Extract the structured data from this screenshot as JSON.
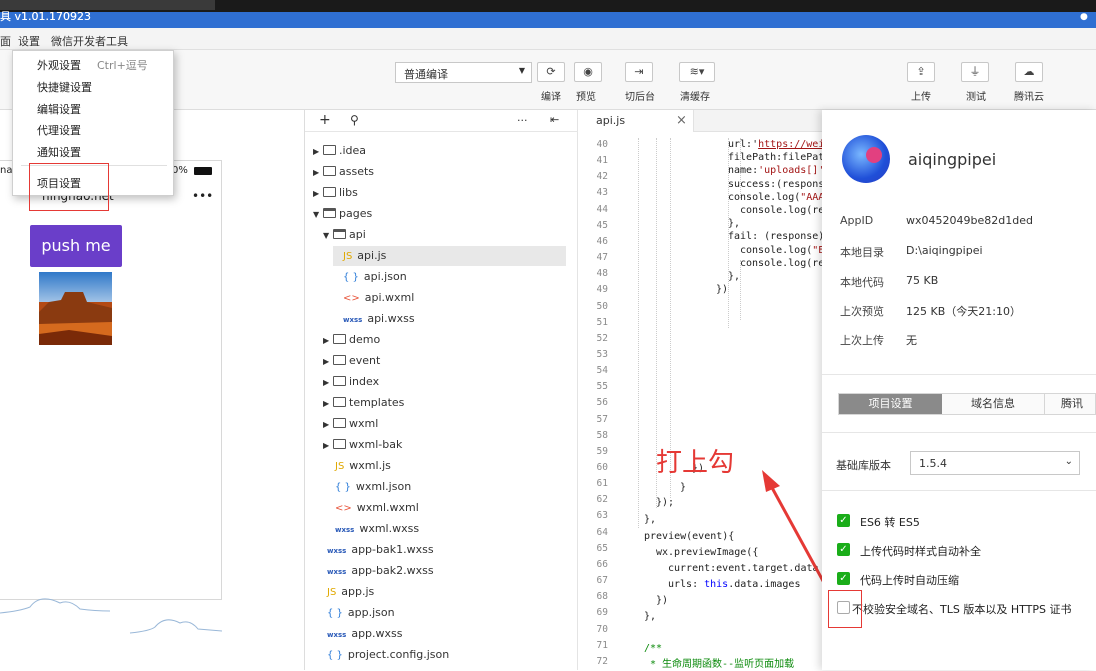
{
  "window": {
    "title_fragment": "具 v1.01.170923"
  },
  "menubar": {
    "items": [
      "面",
      "设置",
      "微信开发者工具"
    ]
  },
  "dropdown": {
    "items": [
      {
        "label": "外观设置",
        "shortcut": "Ctrl+逗号"
      },
      {
        "label": "快捷键设置"
      },
      {
        "label": "编辑设置"
      },
      {
        "label": "代理设置"
      },
      {
        "label": "通知设置"
      },
      {
        "label": "项目设置"
      }
    ]
  },
  "toolbar": {
    "compile_mode": "普通编译",
    "compile_label": "编译",
    "preview_label": "预览",
    "background_label": "切后台",
    "clear_cache_label": "清缓存",
    "upload_label": "上传",
    "test_label": "测试",
    "cloud_label": "腾讯云"
  },
  "simulator": {
    "status_left": "nat",
    "battery_text": "0%",
    "nav_title": "ninghao.net",
    "more": "•••",
    "button_label": "push me"
  },
  "file_tree": {
    "add": "+",
    "search": "⚲",
    "more": "···",
    "collapse": "⇤",
    "items": [
      {
        "name": ".idea",
        "type": "folder"
      },
      {
        "name": "assets",
        "type": "folder"
      },
      {
        "name": "libs",
        "type": "folder"
      },
      {
        "name": "pages",
        "type": "folder-open"
      },
      {
        "name": "api",
        "type": "folder-open"
      },
      {
        "name": "api.js",
        "type": "js"
      },
      {
        "name": "api.json",
        "type": "json"
      },
      {
        "name": "api.wxml",
        "type": "wxml"
      },
      {
        "name": "api.wxss",
        "type": "wxss"
      },
      {
        "name": "demo",
        "type": "folder"
      },
      {
        "name": "event",
        "type": "folder"
      },
      {
        "name": "index",
        "type": "folder"
      },
      {
        "name": "templates",
        "type": "folder"
      },
      {
        "name": "wxml",
        "type": "folder"
      },
      {
        "name": "wxml-bak",
        "type": "folder"
      },
      {
        "name": "wxml.js",
        "type": "js"
      },
      {
        "name": "wxml.json",
        "type": "json"
      },
      {
        "name": "wxml.wxml",
        "type": "wxml"
      },
      {
        "name": "wxml.wxss",
        "type": "wxss"
      },
      {
        "name": "app-bak1.wxss",
        "type": "wxss"
      },
      {
        "name": "app-bak2.wxss",
        "type": "wxss"
      },
      {
        "name": "app.js",
        "type": "js"
      },
      {
        "name": "app.json",
        "type": "json"
      },
      {
        "name": "app.wxss",
        "type": "wxss"
      },
      {
        "name": "project.config.json",
        "type": "json"
      }
    ]
  },
  "editor": {
    "tab_label": "api.js",
    "tab_close": "×",
    "line_numbers": [
      "40",
      "41",
      "42",
      "43",
      "44",
      "45",
      "46",
      "47",
      "48",
      "49",
      "50",
      "51",
      "52",
      "53",
      "54",
      "55",
      "56",
      "57",
      "58",
      "59",
      "60",
      "61",
      "62",
      "63",
      "64",
      "65",
      "66",
      "67",
      "68",
      "69",
      "70",
      "71",
      "72"
    ],
    "code": {
      "l40a": "url:'",
      "l40b": "https://wei",
      "l41": "filePath:filePat",
      "l42a": "name:",
      "l42b": "'uploads[]'",
      "l43": "success:(respons",
      "l44a": "console.log(",
      "l44b": "\"AAA",
      "l45": "console.log(re",
      "l46": "},",
      "l47": "fail: (response)",
      "l48a": "console.log(",
      "l48b": "\"E",
      "l49": "console.log(re",
      "l50": "},",
      "l51": "})",
      "l60": "})",
      "l61": "}",
      "l62": "});",
      "l63": "},",
      "l64": "preview(event){",
      "l65": "wx.previewImage({",
      "l66": "current:event.target.data",
      "l67a": "urls: ",
      "l67b": "this",
      "l67c": ".data.images",
      "l68": "})",
      "l69": "},",
      "l71": "/**",
      "l72": " * 生命周期函数--监听页面加载"
    },
    "annotation": "打上勾"
  },
  "details": {
    "project_name": "aiqingpipei",
    "appid_label": "AppID",
    "appid_value": "wx0452049be82d1ded",
    "dir_label": "本地目录",
    "dir_value": "D:\\aiqingpipei",
    "code_label": "本地代码",
    "code_value": "75 KB",
    "preview_label": "上次预览",
    "preview_value": "125 KB（今天21:10）",
    "upload_label": "上次上传",
    "upload_value": "无",
    "tabs": [
      "项目设置",
      "域名信息",
      "腾讯"
    ],
    "lib_label": "基础库版本",
    "lib_value": "1.5.4",
    "checkboxes": [
      {
        "label": "ES6 转 ES5",
        "checked": true
      },
      {
        "label": "上传代码时样式自动补全",
        "checked": true
      },
      {
        "label": "代码上传时自动压缩",
        "checked": true
      },
      {
        "label": "不校验安全域名、TLS 版本以及 HTTPS 证书",
        "checked": false
      }
    ]
  },
  "colors": {
    "accent": "#1aad19",
    "title_bar": "#2f6fd2",
    "push_button": "#6a3ec9",
    "annotation_red": "#e53935"
  }
}
